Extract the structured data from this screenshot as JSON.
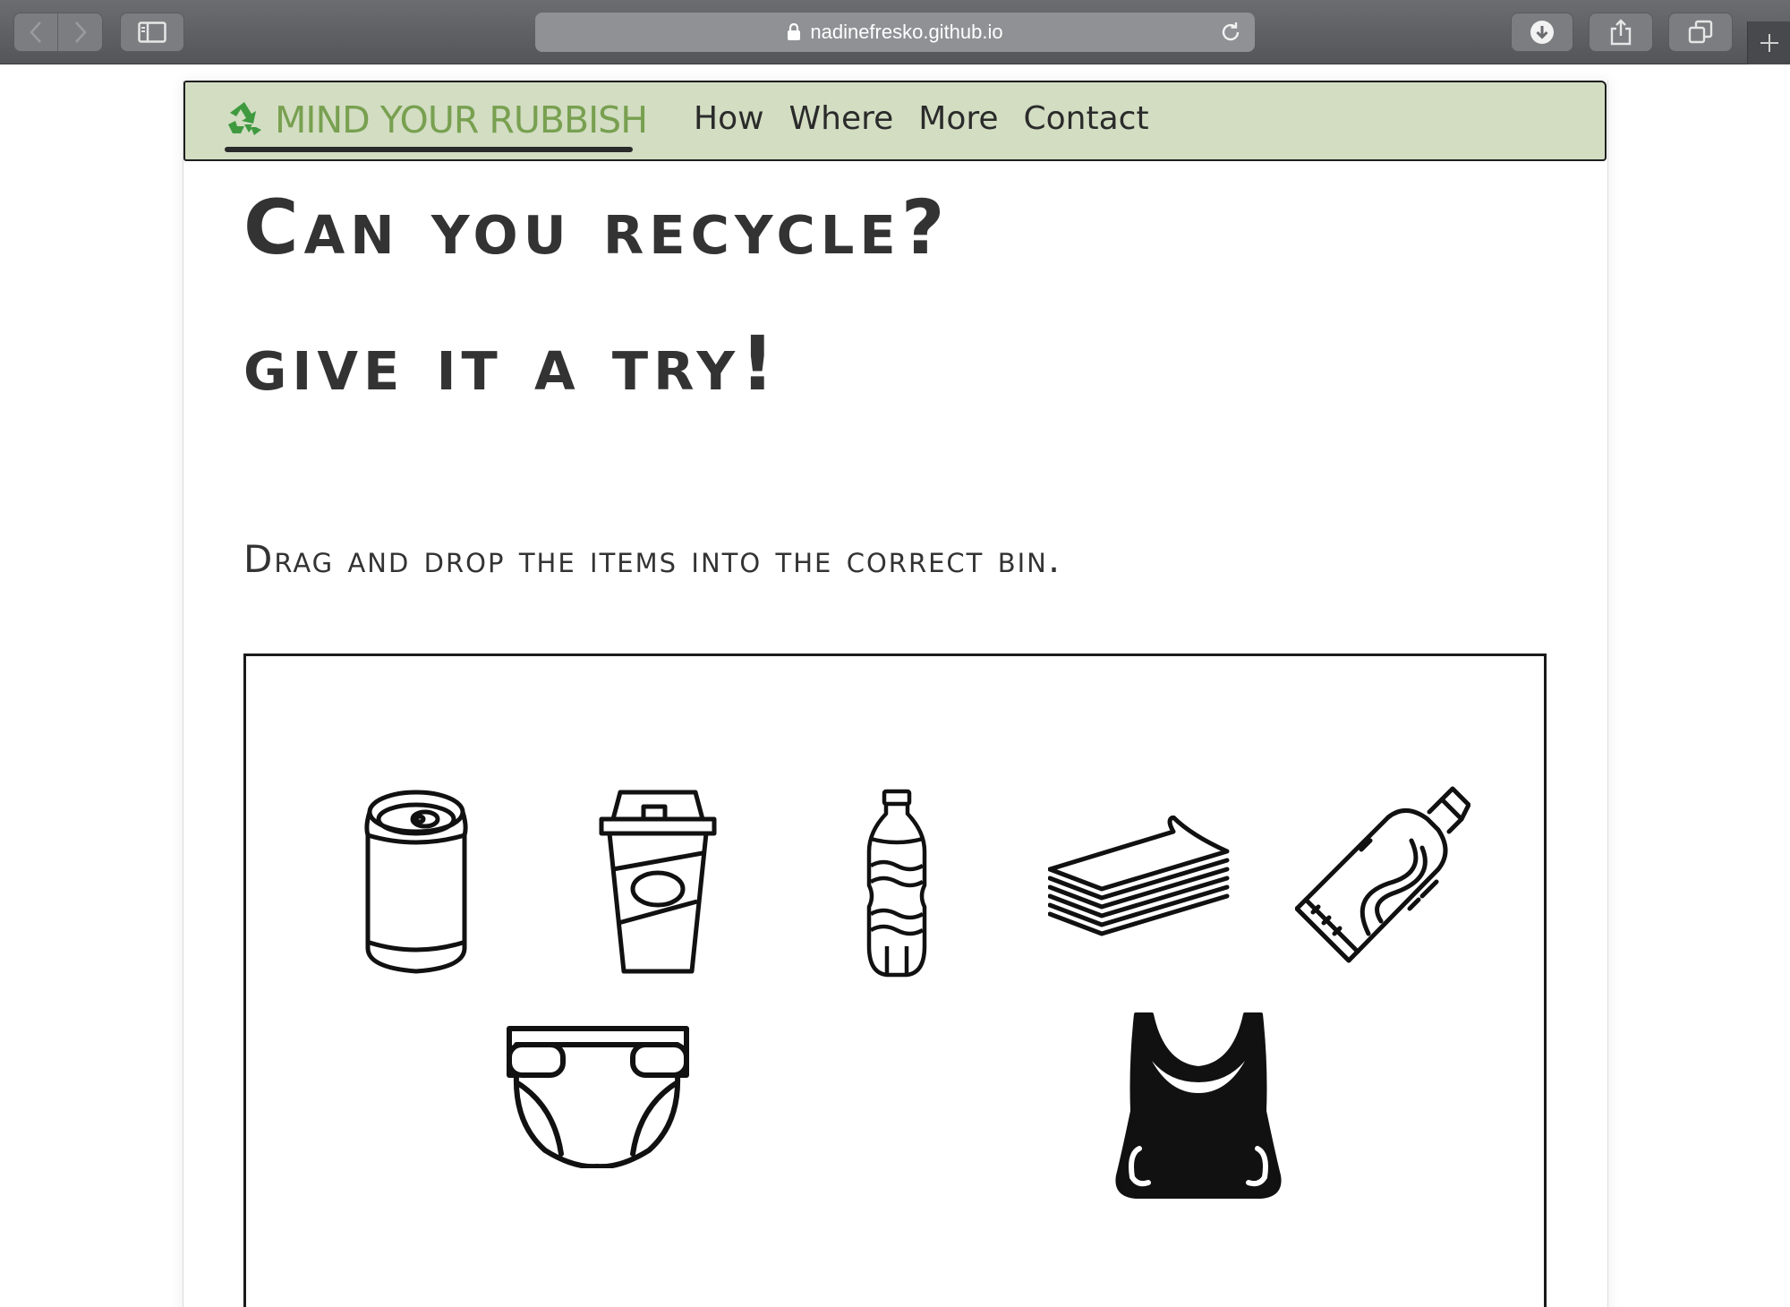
{
  "browser": {
    "url": "nadinefresko.github.io",
    "icons": {
      "back": "chevron-left-icon",
      "forward": "chevron-right-icon",
      "sidebar": "sidebar-icon",
      "lock": "lock-icon",
      "reload": "reload-icon",
      "download": "download-icon",
      "share": "share-icon",
      "tabs": "tabs-icon",
      "new_tab": "plus-icon"
    }
  },
  "site": {
    "brand": "MIND YOUR RUBBISH",
    "brand_icon": "recycle-icon",
    "nav": [
      "How",
      "Where",
      "More",
      "Contact"
    ],
    "colors": {
      "nav_background": "#d2ddc2",
      "brand_green": "#78a050",
      "recycle_icon": "#3f9a3f",
      "text": "#333333"
    }
  },
  "main": {
    "title_line1": "Can you recycle?",
    "title_line2": "give it a try!",
    "instruction": "Drag and drop the items into the correct bin."
  },
  "game": {
    "items": [
      {
        "name": "can",
        "icon": "soda-can-icon"
      },
      {
        "name": "coffee cup",
        "icon": "coffee-cup-icon"
      },
      {
        "name": "water bottle",
        "icon": "water-bottle-icon"
      },
      {
        "name": "paper stack",
        "icon": "paper-stack-icon"
      },
      {
        "name": "tube",
        "icon": "toothpaste-tube-icon"
      },
      {
        "name": "diaper",
        "icon": "diaper-icon"
      },
      {
        "name": "plastic bag",
        "icon": "plastic-bag-icon"
      }
    ]
  }
}
